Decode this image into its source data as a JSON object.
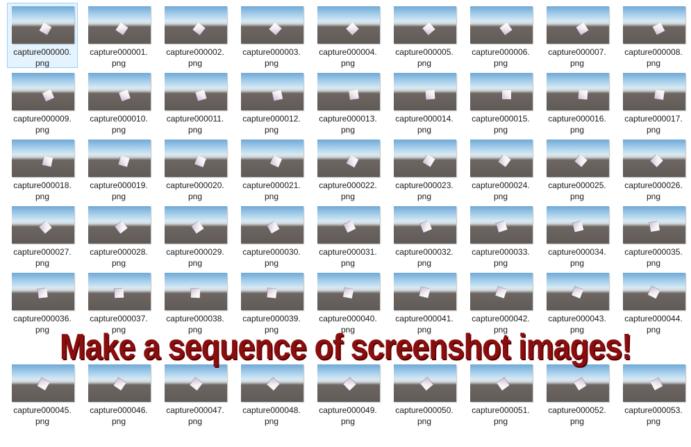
{
  "files": [
    {
      "name": "capture000000.",
      "ext": "png",
      "selected": true
    },
    {
      "name": "capture000001.",
      "ext": "png"
    },
    {
      "name": "capture000002.",
      "ext": "png"
    },
    {
      "name": "capture000003.",
      "ext": "png"
    },
    {
      "name": "capture000004.",
      "ext": "png"
    },
    {
      "name": "capture000005.",
      "ext": "png"
    },
    {
      "name": "capture000006.",
      "ext": "png"
    },
    {
      "name": "capture000007.",
      "ext": "png"
    },
    {
      "name": "capture000008.",
      "ext": "png"
    },
    {
      "name": "capture000009.",
      "ext": "png"
    },
    {
      "name": "capture000010.",
      "ext": "png"
    },
    {
      "name": "capture000011.",
      "ext": "png"
    },
    {
      "name": "capture000012.",
      "ext": "png"
    },
    {
      "name": "capture000013.",
      "ext": "png"
    },
    {
      "name": "capture000014.",
      "ext": "png"
    },
    {
      "name": "capture000015.",
      "ext": "png"
    },
    {
      "name": "capture000016.",
      "ext": "png"
    },
    {
      "name": "capture000017.",
      "ext": "png"
    },
    {
      "name": "capture000018.",
      "ext": "png"
    },
    {
      "name": "capture000019.",
      "ext": "png"
    },
    {
      "name": "capture000020.",
      "ext": "png"
    },
    {
      "name": "capture000021.",
      "ext": "png"
    },
    {
      "name": "capture000022.",
      "ext": "png"
    },
    {
      "name": "capture000023.",
      "ext": "png"
    },
    {
      "name": "capture000024.",
      "ext": "png"
    },
    {
      "name": "capture000025.",
      "ext": "png"
    },
    {
      "name": "capture000026.",
      "ext": "png"
    },
    {
      "name": "capture000027.",
      "ext": "png"
    },
    {
      "name": "capture000028.",
      "ext": "png"
    },
    {
      "name": "capture000029.",
      "ext": "png"
    },
    {
      "name": "capture000030.",
      "ext": "png"
    },
    {
      "name": "capture000031.",
      "ext": "png"
    },
    {
      "name": "capture000032.",
      "ext": "png"
    },
    {
      "name": "capture000033.",
      "ext": "png"
    },
    {
      "name": "capture000034.",
      "ext": "png"
    },
    {
      "name": "capture000035.",
      "ext": "png"
    },
    {
      "name": "capture000036.",
      "ext": "png"
    },
    {
      "name": "capture000037.",
      "ext": "png"
    },
    {
      "name": "capture000038.",
      "ext": "png"
    },
    {
      "name": "capture000039.",
      "ext": "png"
    },
    {
      "name": "capture000040.",
      "ext": "png"
    },
    {
      "name": "capture000041.",
      "ext": "png"
    },
    {
      "name": "capture000042.",
      "ext": "png"
    },
    {
      "name": "capture000043.",
      "ext": "png"
    },
    {
      "name": "capture000044.",
      "ext": "png"
    },
    {
      "name": "capture000045.",
      "ext": "png"
    },
    {
      "name": "capture000046.",
      "ext": "png"
    },
    {
      "name": "capture000047.",
      "ext": "png"
    },
    {
      "name": "capture000048.",
      "ext": "png"
    },
    {
      "name": "capture000049.",
      "ext": "png"
    },
    {
      "name": "capture000050.",
      "ext": "png"
    },
    {
      "name": "capture000051.",
      "ext": "png"
    },
    {
      "name": "capture000052.",
      "ext": "png"
    },
    {
      "name": "capture000053.",
      "ext": "png"
    }
  ],
  "banner": {
    "text": "Make a sequence of screenshot images!",
    "color": "#8a0e0e"
  },
  "colors": {
    "selection_bg": "#e5f3ff",
    "selection_border": "#99d1ff",
    "label_text": "#1a1a1a"
  }
}
